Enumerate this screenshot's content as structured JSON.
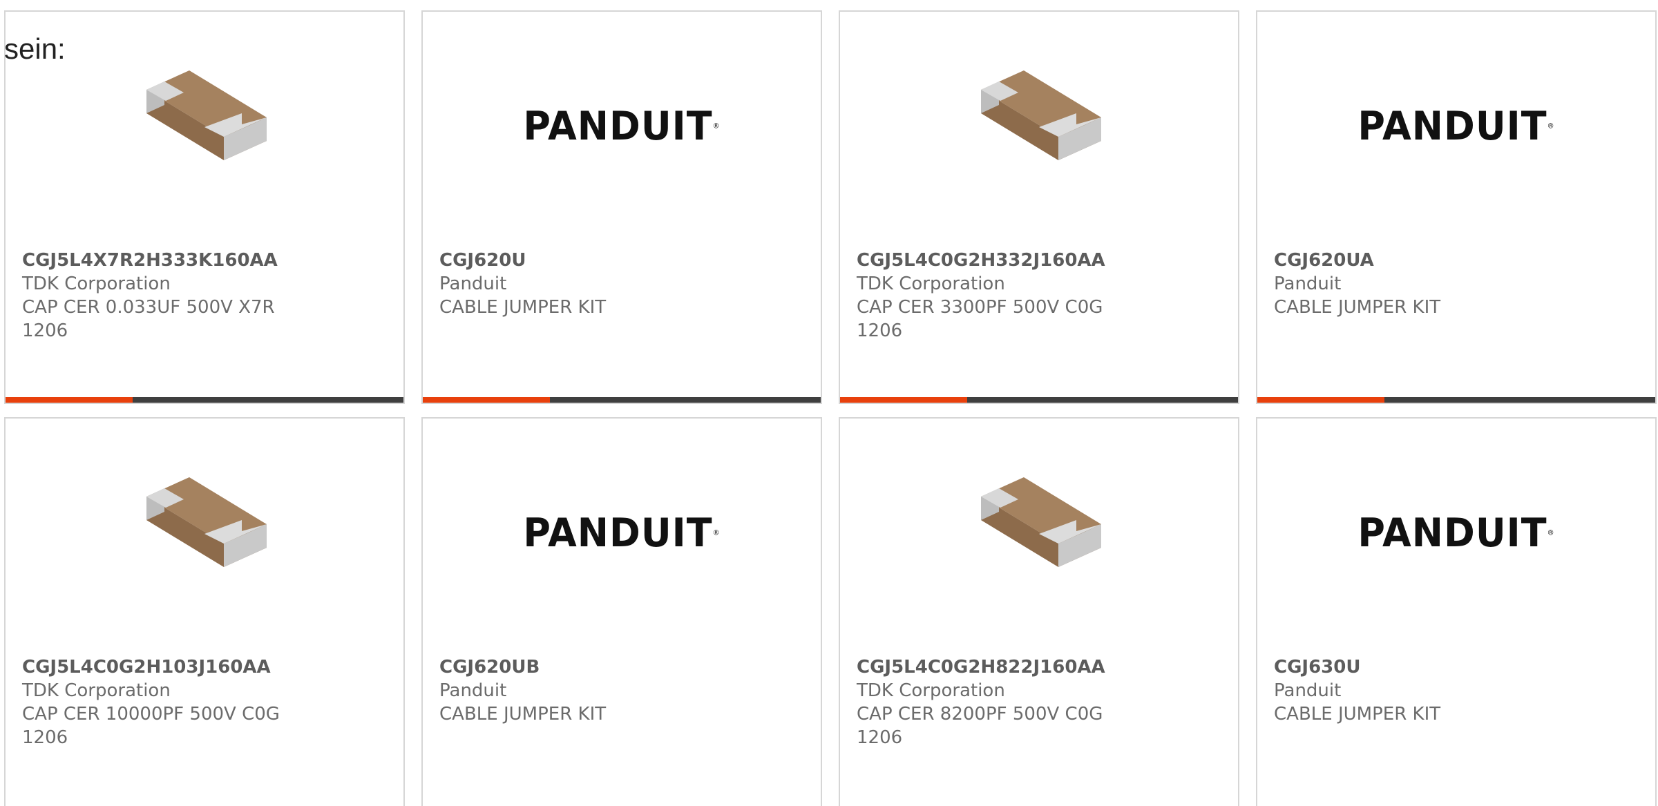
{
  "intro": "sein:",
  "colors": {
    "accent": "#e8400c",
    "bar": "#3f3f3f",
    "border": "#d6d6d6",
    "capacitor_body": "#a5825f",
    "capacitor_terminal": "#c9c9c9"
  },
  "panduit_logo": "PANDUIT",
  "products": [
    {
      "part": "CGJ5L4X7R2H333K160AA",
      "maker": "TDK Corporation",
      "desc": "CAP CER 0.033UF 500V X7R 1206",
      "image": "capacitor-chip-icon",
      "progress": 0.32
    },
    {
      "part": "CGJ620U",
      "maker": "Panduit",
      "desc": "CABLE JUMPER KIT",
      "image": "panduit-logo",
      "progress": 0.32
    },
    {
      "part": "CGJ5L4C0G2H332J160AA",
      "maker": "TDK Corporation",
      "desc": "CAP CER 3300PF 500V C0G 1206",
      "image": "capacitor-chip-icon",
      "progress": 0.32
    },
    {
      "part": "CGJ620UA",
      "maker": "Panduit",
      "desc": "CABLE JUMPER KIT",
      "image": "panduit-logo",
      "progress": 0.32
    },
    {
      "part": "CGJ5L4C0G2H103J160AA",
      "maker": "TDK Corporation",
      "desc": "CAP CER 10000PF 500V C0G 1206",
      "image": "capacitor-chip-icon"
    },
    {
      "part": "CGJ620UB",
      "maker": "Panduit",
      "desc": "CABLE JUMPER KIT",
      "image": "panduit-logo"
    },
    {
      "part": "CGJ5L4C0G2H822J160AA",
      "maker": "TDK Corporation",
      "desc": "CAP CER 8200PF 500V C0G 1206",
      "image": "capacitor-chip-icon"
    },
    {
      "part": "CGJ630U",
      "maker": "Panduit",
      "desc": "CABLE JUMPER KIT",
      "image": "panduit-logo"
    }
  ]
}
